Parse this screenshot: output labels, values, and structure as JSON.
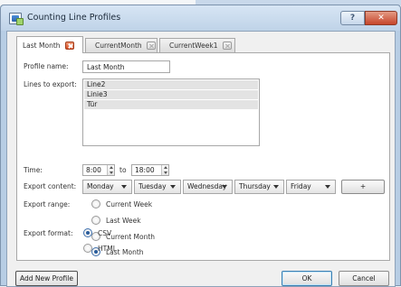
{
  "window": {
    "title": "Counting Line Profiles",
    "help_label": "?",
    "close_label": "✕",
    "icon": "app-window-icon"
  },
  "tabs": [
    {
      "label": "Last Month",
      "active": true
    },
    {
      "label": "CurrentMonth",
      "active": false
    },
    {
      "label": "CurrentWeek1",
      "active": false
    }
  ],
  "form": {
    "profile_name_label": "Profile name:",
    "profile_name_value": "Last Month",
    "lines_label": "Lines to export:",
    "lines": [
      "Line2",
      "Linie3",
      "Tür"
    ],
    "time_label": "Time:",
    "time_from": "8:00",
    "time_to_label": "to",
    "time_to": "18:00",
    "export_content_label": "Export content:",
    "days": [
      "Monday",
      "Tuesday",
      "Wednesday",
      "Thursday",
      "Friday"
    ],
    "add_day_label": "+",
    "export_range_label": "Export range:",
    "ranges": [
      {
        "label": "Current Week",
        "checked": false
      },
      {
        "label": "Last Week",
        "checked": false
      },
      {
        "label": "Current Month",
        "checked": false
      },
      {
        "label": "Last Month",
        "checked": true
      }
    ],
    "export_format_label": "Export format:",
    "formats": [
      {
        "label": "CSV",
        "checked": true
      },
      {
        "label": "HTML",
        "checked": false
      }
    ]
  },
  "footer": {
    "add_profile_label": "Add New Profile",
    "ok_label": "OK",
    "cancel_label": "Cancel"
  },
  "colors": {
    "titlebar": "#c6d9ee",
    "close_button": "#c6452a",
    "active_tab_close": "#d74d24",
    "radio_selected": "#2a5d9c"
  }
}
